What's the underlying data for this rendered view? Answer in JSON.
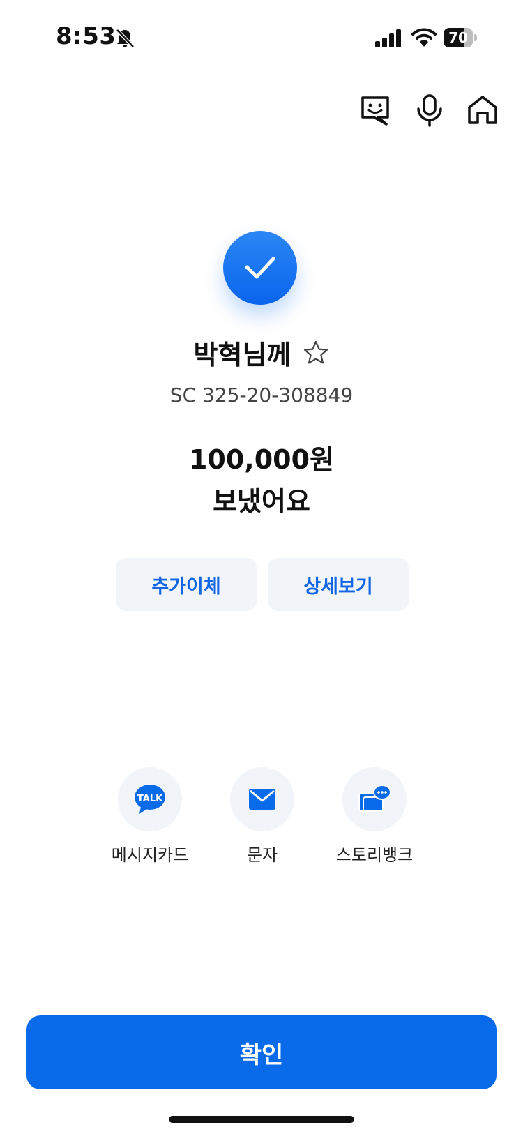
{
  "status_bar": {
    "time": "8:53",
    "battery": "70",
    "battery_level": 0.7,
    "icons": [
      "bell-slash-icon",
      "signal-icon",
      "wifi-icon",
      "battery-icon"
    ]
  },
  "header_icons": [
    "chat-face-icon",
    "mic-icon",
    "home-icon"
  ],
  "result": {
    "icon": "check-icon",
    "recipient": "박혁님께",
    "favorite_icon": "star-outline-icon",
    "account": "SC 325-20-308849",
    "amount": "100,000원",
    "message": "보냈어요"
  },
  "actions": {
    "additional_transfer": "추가이체",
    "details": "상세보기"
  },
  "share": {
    "kakao": {
      "label": "메시지카드",
      "icon_text": "TALK"
    },
    "sms": {
      "label": "문자"
    },
    "story": {
      "label": "스토리뱅크"
    }
  },
  "confirm_label": "확인",
  "colors": {
    "primary": "#0a6bea",
    "button_bg": "#f1f5fa",
    "action_text": "#1166e6"
  }
}
